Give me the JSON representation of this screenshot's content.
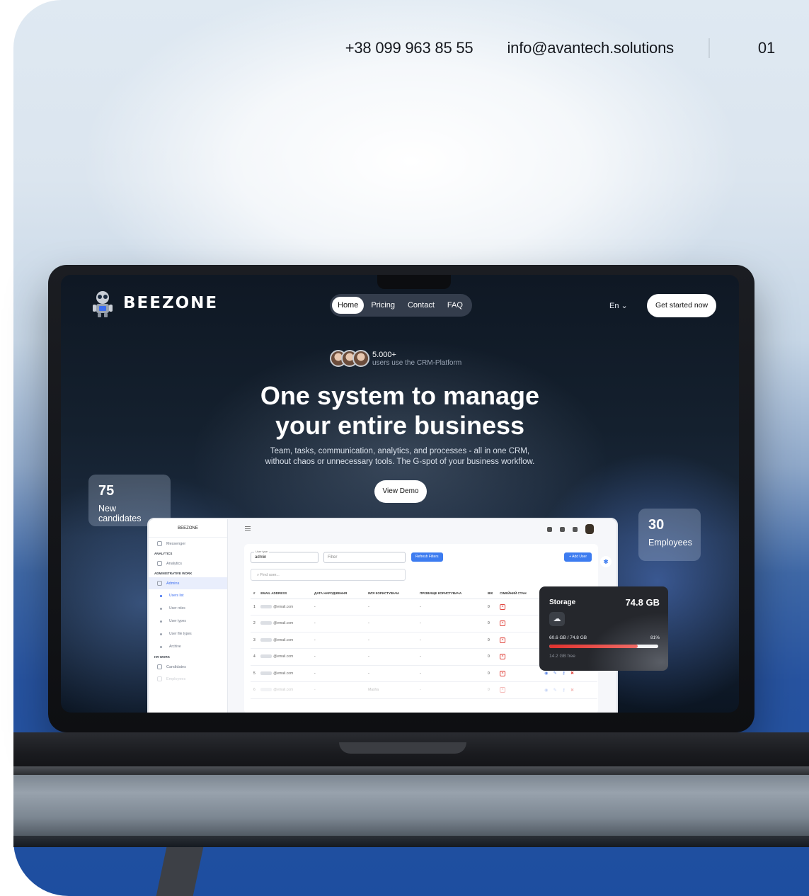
{
  "header": {
    "phone": "+38 099 963 85 55",
    "email": "info@avantech.solutions",
    "page_number": "01"
  },
  "site": {
    "brand": "BEEZONE",
    "nav": [
      "Home",
      "Pricing",
      "Contact",
      "FAQ"
    ],
    "active_nav": "Home",
    "language": "En",
    "cta": "Get started now",
    "users_count": "5.000+",
    "users_text": "users use the CRM-Platform",
    "hero_line1": "One system to manage",
    "hero_line2": "your entire business",
    "hero_sub1": "Team, tasks, communication, analytics, and processes - all in one CRM,",
    "hero_sub2": "without chaos or unnecessary tools. The G-spot of your business workflow.",
    "demo_button": "View Demo"
  },
  "stats": {
    "candidates_num": "75",
    "candidates_label": "New candidates",
    "employees_num": "30",
    "employees_label": "Employees"
  },
  "dashboard": {
    "brand": "BEEZONE",
    "sidebar": {
      "messenger": "Messenger",
      "analytics_section": "ANALYTICS",
      "analytics": "Analytics",
      "admin_section": "ADMINISTRATIVE WORK",
      "admins": "Admins",
      "users_list": "Users list",
      "user_roles": "User roles",
      "user_types": "User types",
      "user_file_types": "User file types",
      "archive": "Archive",
      "hr_section": "HR WORK",
      "candidates": "Candidates",
      "employees": "Employees"
    },
    "user_type_label": "User type",
    "user_type_value": "admin",
    "filter_placeholder": "Filter",
    "refresh_button": "Refresh Filters",
    "add_user_button": "+ Add User",
    "find_placeholder": "Find user...",
    "columns": [
      "#",
      "EMAIL ADDRESS",
      "ДАТА НАРОДЖЕННЯ",
      "ІМ'Я КОРИСТУВАЧА",
      "ПРІЗВИЩЕ КОРИСТУВАЧА",
      "ВІК",
      "СІМЕЙНИЙ СТАН"
    ],
    "rows": [
      {
        "n": "1",
        "email": "@email.com",
        "dob": "-",
        "first": "-",
        "last": "-",
        "age": "0"
      },
      {
        "n": "2",
        "email": "@email.com",
        "dob": "-",
        "first": "-",
        "last": "-",
        "age": "0"
      },
      {
        "n": "3",
        "email": "@email.com",
        "dob": "-",
        "first": "-",
        "last": "-",
        "age": "0"
      },
      {
        "n": "4",
        "email": "@email.com",
        "dob": "-",
        "first": "-",
        "last": "-",
        "age": "0"
      },
      {
        "n": "5",
        "email": "@email.com",
        "dob": "-",
        "first": "-",
        "last": "-",
        "age": "0"
      },
      {
        "n": "6",
        "email": "@email.com",
        "dob": "-",
        "first": "Masha",
        "last": "-",
        "age": "0"
      }
    ]
  },
  "storage": {
    "title": "Storage",
    "total": "74.8 GB",
    "usage": "60.6 GB / 74.8 GB",
    "percent": "81%",
    "used_fraction": 0.81,
    "free": "14.2 GB free",
    "bar_color": "#e0322e"
  }
}
